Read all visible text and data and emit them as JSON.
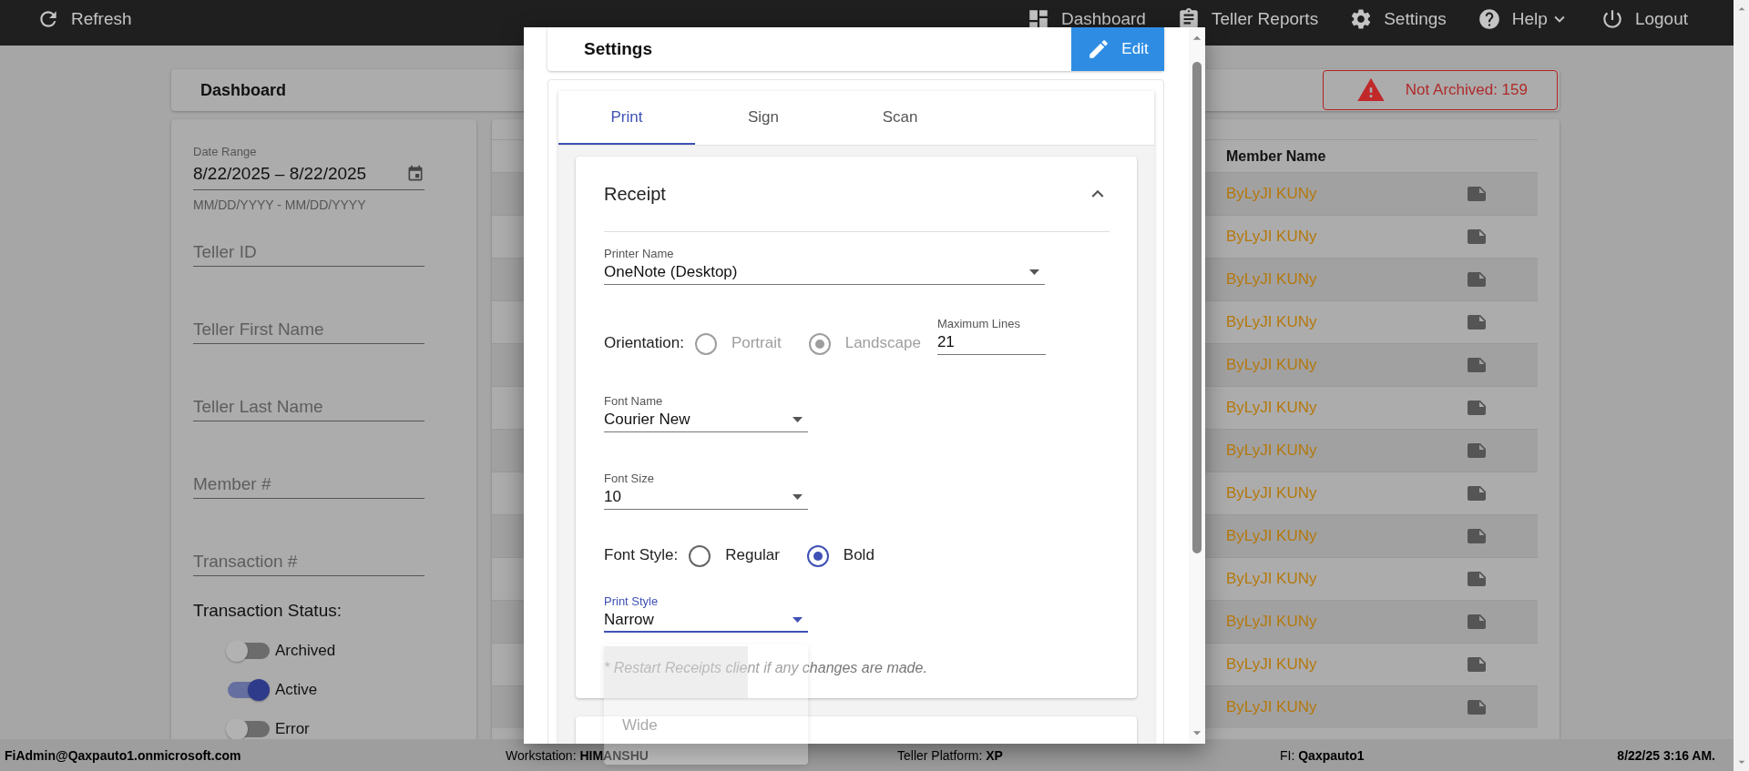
{
  "top_bar": {
    "refresh": "Refresh",
    "nav": [
      {
        "label": "Dashboard"
      },
      {
        "label": "Teller Reports"
      },
      {
        "label": "Settings"
      },
      {
        "label": "Help",
        "kind": "menu"
      },
      {
        "label": "Logout"
      }
    ]
  },
  "dashboard_header": {
    "title": "Dashboard",
    "alert": "Not Archived: 159"
  },
  "filters": {
    "date_range": {
      "label": "Date Range",
      "value": "8/22/2025 – 8/22/2025",
      "helper": "MM/DD/YYYY - MM/DD/YYYY"
    },
    "fields": [
      {
        "placeholder": "Teller ID"
      },
      {
        "placeholder": "Teller First Name"
      },
      {
        "placeholder": "Teller Last Name"
      },
      {
        "placeholder": "Member #"
      },
      {
        "placeholder": "Transaction #"
      }
    ],
    "status_title": "Transaction Status:",
    "toggles": [
      {
        "label": "Archived",
        "on": false
      },
      {
        "label": "Active",
        "on": true
      },
      {
        "label": "Error",
        "on": false
      }
    ]
  },
  "table": {
    "columns": [
      "Member Name"
    ],
    "rows": [
      {
        "member_name": "ByLyJI KUNy"
      },
      {
        "member_name": "ByLyJI KUNy"
      },
      {
        "member_name": "ByLyJI KUNy"
      },
      {
        "member_name": "ByLyJI KUNy"
      },
      {
        "member_name": "ByLyJI KUNy"
      },
      {
        "member_name": "ByLyJI KUNy"
      },
      {
        "member_name": "ByLyJI KUNy"
      },
      {
        "member_name": "ByLyJI KUNy"
      },
      {
        "member_name": "ByLyJI KUNy"
      },
      {
        "member_name": "ByLyJI KUNy"
      },
      {
        "member_name": "ByLyJI KUNy"
      },
      {
        "member_name": "ByLyJI KUNy"
      },
      {
        "member_name": "ByLyJI KUNy"
      }
    ]
  },
  "status_bar": {
    "user": "FiAdmin@Qaxpauto1.onmicrosoft.com",
    "items": [
      {
        "label": "Workstation:",
        "value": "HIMANSHU"
      },
      {
        "label": "Teller Platform:",
        "value": "XP"
      },
      {
        "label": "FI:",
        "value": "Qaxpauto1"
      }
    ],
    "datetime": "8/22/25 3:16 AM."
  },
  "settings_dialog": {
    "title": "Settings",
    "edit_button": "Edit",
    "tabs": [
      {
        "label": "Print",
        "selected": true
      },
      {
        "label": "Sign",
        "selected": false
      },
      {
        "label": "Scan",
        "selected": false
      }
    ],
    "sections": [
      {
        "kind": "open",
        "title": "Receipt",
        "printer_name": {
          "label": "Printer Name",
          "value": "OneNote (Desktop)"
        },
        "orientation": {
          "label": "Orientation:",
          "disabled": true,
          "options": [
            {
              "label": "Portrait",
              "selected": false
            },
            {
              "label": "Landscape",
              "selected": true
            }
          ]
        },
        "max_lines": {
          "label": "Maximum Lines",
          "value": "21"
        },
        "font_name": {
          "label": "Font Name",
          "value": "Courier New"
        },
        "font_size": {
          "label": "Font Size",
          "value": "10"
        },
        "font_style": {
          "label": "Font Style:",
          "disabled": false,
          "options": [
            {
              "label": "Regular",
              "selected": false
            },
            {
              "label": "Bold",
              "selected": true
            }
          ]
        },
        "print_style": {
          "label": "Print Style",
          "value": "Narrow",
          "focused": true,
          "menu": [
            {
              "selected": true
            },
            {
              "label": "Wide",
              "selected": false
            }
          ]
        },
        "note": "* Restart Receipts client if any changes are made."
      },
      {
        "kind": "closed"
      }
    ]
  }
}
